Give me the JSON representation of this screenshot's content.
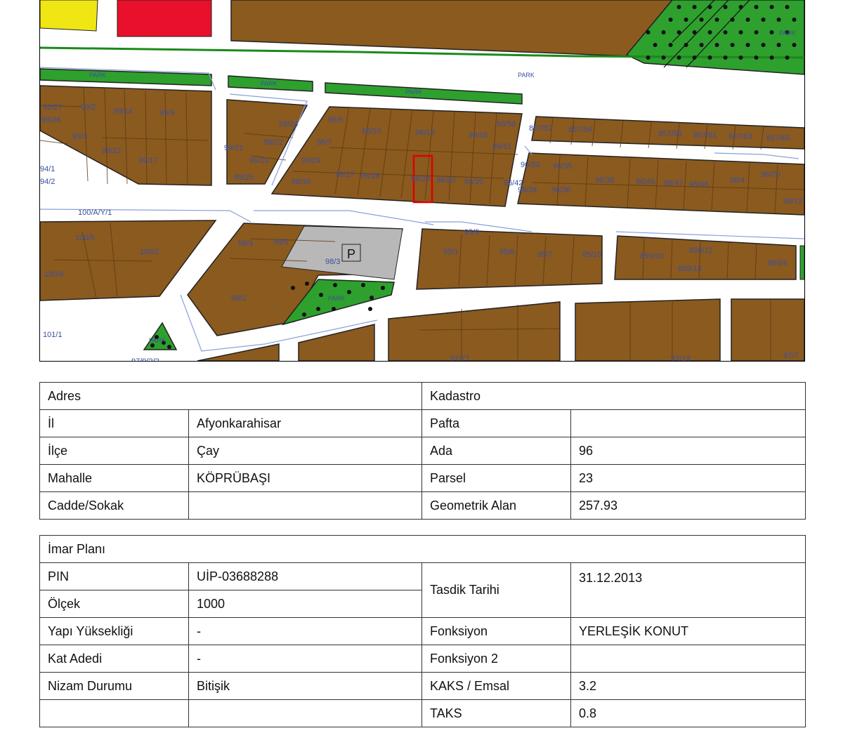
{
  "map": {
    "park_label": "PARK",
    "parking_label": "P",
    "parcel_labels": [
      {
        "t": "99/27"
      },
      {
        "t": "99/2"
      },
      {
        "t": "99/14"
      },
      {
        "t": "99/9"
      },
      {
        "t": "99/26"
      },
      {
        "t": "99/3"
      },
      {
        "t": "99/12"
      },
      {
        "t": "99/17"
      },
      {
        "t": "99/21"
      },
      {
        "t": "99/22"
      },
      {
        "t": "99/23"
      },
      {
        "t": "99/24"
      },
      {
        "t": "99/25"
      },
      {
        "t": "96/8"
      },
      {
        "t": "96/10"
      },
      {
        "t": "96/13"
      },
      {
        "t": "96/16"
      },
      {
        "t": "96/50"
      },
      {
        "t": "96/51"
      },
      {
        "t": "96/7"
      },
      {
        "t": "96/29"
      },
      {
        "t": "96/27"
      },
      {
        "t": "96/26"
      },
      {
        "t": "96/30"
      },
      {
        "t": "96/23"
      },
      {
        "t": "96/80"
      },
      {
        "t": "96/20"
      },
      {
        "t": "96/42"
      },
      {
        "t": "96/34"
      },
      {
        "t": "96/33"
      },
      {
        "t": "96/35"
      },
      {
        "t": "96/38"
      },
      {
        "t": "96/36"
      },
      {
        "t": "96/46"
      },
      {
        "t": "96/47"
      },
      {
        "t": "96/48"
      },
      {
        "t": "96/4"
      },
      {
        "t": "96/70"
      },
      {
        "t": "96/72"
      },
      {
        "t": "857/52"
      },
      {
        "t": "857/54"
      },
      {
        "t": "857/59"
      },
      {
        "t": "857/61"
      },
      {
        "t": "857/63"
      },
      {
        "t": "857/65"
      },
      {
        "t": "100/A/Y/1"
      },
      {
        "t": "100/5"
      },
      {
        "t": "100/2"
      },
      {
        "t": "100/6"
      },
      {
        "t": "101/1"
      },
      {
        "t": "98/4"
      },
      {
        "t": "98/5"
      },
      {
        "t": "98/3"
      },
      {
        "t": "98/2"
      },
      {
        "t": "95/9"
      },
      {
        "t": "95/1"
      },
      {
        "t": "95/6"
      },
      {
        "t": "95/7"
      },
      {
        "t": "95/10"
      },
      {
        "t": "859/10"
      },
      {
        "t": "859/12"
      },
      {
        "t": "859/13"
      },
      {
        "t": "859/4"
      },
      {
        "t": "97/77"
      },
      {
        "t": "97/13"
      },
      {
        "t": "97/7"
      },
      {
        "t": "97/9/2/2"
      },
      {
        "t": "94/1"
      },
      {
        "t": "94/2"
      }
    ]
  },
  "adres": {
    "header": "Adres",
    "rows": [
      {
        "label": "İl",
        "value": "Afyonkarahisar"
      },
      {
        "label": "İlçe",
        "value": "Çay"
      },
      {
        "label": "Mahalle",
        "value": "KÖPRÜBAŞI"
      },
      {
        "label": "Cadde/Sokak",
        "value": ""
      }
    ]
  },
  "kadastro": {
    "header": "Kadastro",
    "rows": [
      {
        "label": "Pafta",
        "value": ""
      },
      {
        "label": "Ada",
        "value": "96"
      },
      {
        "label": "Parsel",
        "value": "23"
      },
      {
        "label": "Geometrik Alan",
        "value": "257.93"
      }
    ]
  },
  "imar": {
    "header": "İmar Planı",
    "left": [
      {
        "label": "PIN",
        "value": "UİP-03688288"
      },
      {
        "label": "Ölçek",
        "value": "1000"
      },
      {
        "label": "Yapı Yüksekliği",
        "value": "-"
      },
      {
        "label": "Kat Adedi",
        "value": "-"
      },
      {
        "label": "Nizam Durumu",
        "value": "Bitişik"
      },
      {
        "label": "",
        "value": ""
      }
    ],
    "tasdik": {
      "label": "Tasdik Tarihi",
      "value": "31.12.2013"
    },
    "right": [
      {
        "label": "Fonksiyon",
        "value": "YERLEŞİK KONUT"
      },
      {
        "label": "Fonksiyon 2",
        "value": ""
      },
      {
        "label": "KAKS / Emsal",
        "value": "3.2"
      },
      {
        "label": "TAKS",
        "value": "0.8"
      }
    ]
  },
  "colors": {
    "residential": "#8b5a1f",
    "park": "#2ea02e",
    "road_line": "#1a8a1a",
    "parking": "#b8b8b8",
    "selected_parcel": "#e00000",
    "commercial": "#e8102a",
    "yellow_zone": "#f0e614",
    "parcel_line": "#8aa0d8"
  }
}
